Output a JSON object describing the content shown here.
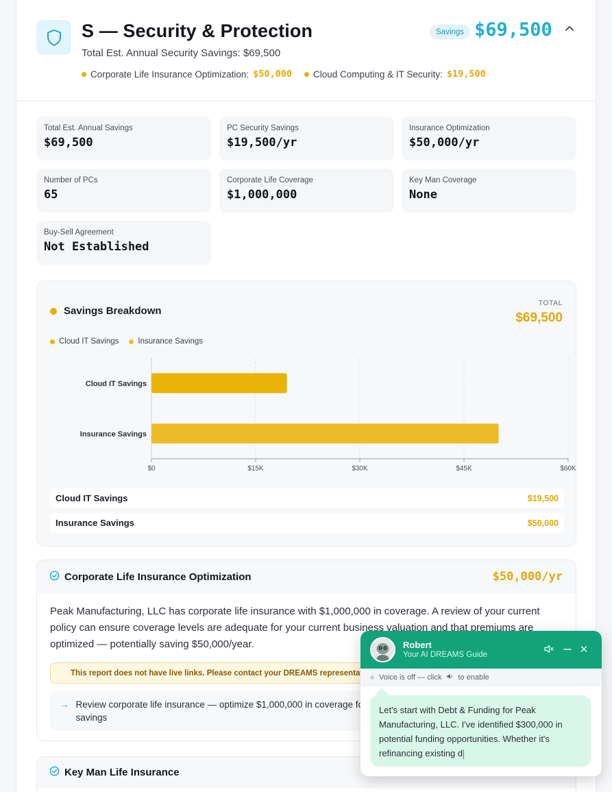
{
  "header": {
    "title": "S — Security & Protection",
    "subtitle": "Total Est. Annual Security Savings: $69,500",
    "badge": "Savings",
    "amount": "$69,500",
    "items": [
      {
        "label": "Corporate Life Insurance Optimization:",
        "value": "$50,000"
      },
      {
        "label": "Cloud Computing & IT Security:",
        "value": "$19,500"
      }
    ],
    "icon": "shield-icon"
  },
  "stats": [
    {
      "label": "Total Est. Annual Savings",
      "value": "$69,500"
    },
    {
      "label": "PC Security Savings",
      "value": "$19,500/yr"
    },
    {
      "label": "Insurance Optimization",
      "value": "$50,000/yr"
    },
    {
      "label": "Number of PCs",
      "value": "65"
    },
    {
      "label": "Corporate Life Coverage",
      "value": "$1,000,000"
    },
    {
      "label": "Key Man Coverage",
      "value": "None"
    },
    {
      "label": "Buy-Sell Agreement",
      "value": "Not Established"
    }
  ],
  "breakdown": {
    "title": "Savings Breakdown",
    "total_label": "TOTAL",
    "total_value": "$69,500",
    "legend": [
      "Cloud IT Savings",
      "Insurance Savings"
    ],
    "rows": [
      {
        "label": "Cloud IT Savings",
        "amount": "$19,500"
      },
      {
        "label": "Insurance Savings",
        "amount": "$50,000"
      }
    ]
  },
  "chart_data": {
    "type": "bar",
    "orientation": "horizontal",
    "categories": [
      "Cloud IT Savings",
      "Insurance Savings"
    ],
    "values": [
      19500,
      50000
    ],
    "colors": [
      "#e9b308",
      "#eebb28"
    ],
    "xlim": [
      0,
      60000
    ],
    "xticks": [
      0,
      15000,
      30000,
      45000,
      60000
    ],
    "xtick_labels": [
      "$0",
      "$15K",
      "$30K",
      "$45K",
      "$60K"
    ],
    "grid": true
  },
  "corporate": {
    "title": "Corporate Life Insurance Optimization",
    "amount": "$50,000/yr",
    "text": "Peak Manufacturing, LLC has corporate life insurance with $1,000,000 in coverage. A review of your current policy can ensure coverage levels are adequate for your current business valuation and that premiums are optimized — potentially saving $50,000/year.",
    "warning": "This report does not have live links. Please contact your DREAMS representative",
    "recommendation": "Review corporate life insurance — optimize $1,000,000 in coverage fo",
    "recommendation_cont": "savings"
  },
  "keyman": {
    "title": "Key Man Life Insurance"
  },
  "chat": {
    "name": "Robert",
    "role": "Your AI DREAMS Guide",
    "voice_a": "Voice is off — click",
    "voice_b": "to enable",
    "message": "Let's start with Debt & Funding for Peak Manufacturing, LLC. I've identified $300,000 in potential funding opportunities. Whether it's refinancing existing d"
  },
  "colors": {
    "accent": "#22aed0",
    "gold": "#e0a909",
    "chat_green": "#12a37b"
  }
}
